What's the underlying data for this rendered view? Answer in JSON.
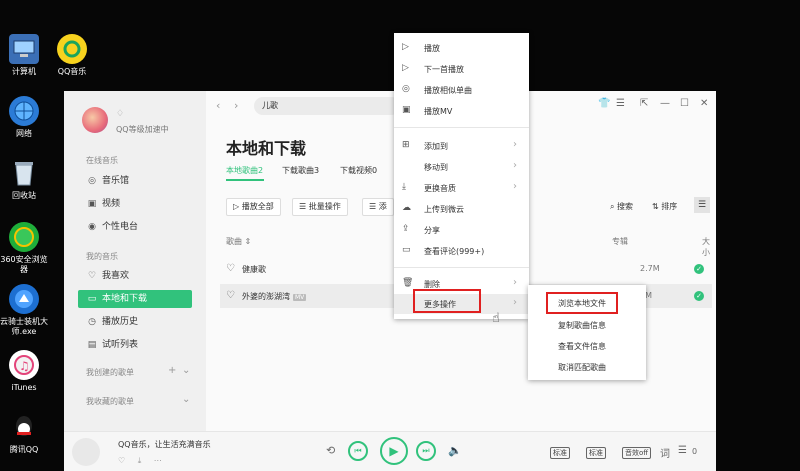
{
  "desktop": {
    "icons": [
      {
        "label": "计算机",
        "icon": "computer-icon"
      },
      {
        "label": "QQ音乐",
        "icon": "qqmusic-icon"
      },
      {
        "label": "网络",
        "icon": "network-icon"
      },
      {
        "label": "回收站",
        "icon": "recycle-bin-icon"
      },
      {
        "label": "360安全浏览器",
        "icon": "browser-icon"
      },
      {
        "label": "云骑士装机大师.exe",
        "icon": "installer-icon"
      },
      {
        "label": "iTunes",
        "icon": "itunes-icon"
      },
      {
        "label": "腾讯QQ",
        "icon": "qq-icon"
      }
    ]
  },
  "sidebar": {
    "user_status": "QQ等级加速中",
    "online_music_label": "在线音乐",
    "online_items": [
      {
        "label": "音乐馆",
        "icon": "music-hall-icon"
      },
      {
        "label": "视频",
        "icon": "video-icon"
      },
      {
        "label": "个性电台",
        "icon": "radio-icon"
      }
    ],
    "my_music_label": "我的音乐",
    "my_items": [
      {
        "label": "我喜欢",
        "icon": "heart-icon"
      },
      {
        "label": "本地和下载",
        "icon": "monitor-icon"
      },
      {
        "label": "播放历史",
        "icon": "history-icon"
      },
      {
        "label": "试听列表",
        "icon": "list-icon"
      }
    ],
    "created_playlists_label": "我创建的歌单",
    "collected_playlists_label": "我收藏的歌单"
  },
  "topbar": {
    "search_value": "儿歌"
  },
  "main": {
    "title": "本地和下载",
    "tabs": [
      "本地歌曲2",
      "下载歌曲3",
      "下载视频0"
    ],
    "buttons": {
      "play_all": "播放全部",
      "batch": "批量操作",
      "add": "添"
    },
    "tools": {
      "search": "搜索",
      "sort": "排序"
    },
    "columns": {
      "song": "歌曲",
      "album": "专辑",
      "size": "大小"
    },
    "songs": [
      {
        "name": "健康歌",
        "mv": "",
        "size": "2.7M"
      },
      {
        "name": "外婆的澎湖湾",
        "mv": "MV",
        "size": "9M"
      }
    ]
  },
  "player": {
    "now_playing": "QQ音乐，让生活充满音乐",
    "mode": "标准",
    "quality": "标准",
    "sound": "音效off",
    "count": "0"
  },
  "context_menu": {
    "items": [
      {
        "label": "播放",
        "icon": "play-icon"
      },
      {
        "label": "下一首播放",
        "icon": "play-next-icon"
      },
      {
        "label": "播放相似单曲",
        "icon": "similar-icon"
      },
      {
        "label": "播放MV",
        "icon": "mv-icon"
      },
      {
        "label": "添加到",
        "icon": "add-icon"
      },
      {
        "label": "移动到",
        "icon": ""
      },
      {
        "label": "更换音质",
        "icon": "download-icon"
      },
      {
        "label": "上传到微云",
        "icon": "cloud-icon"
      },
      {
        "label": "分享",
        "icon": "share-icon"
      },
      {
        "label": "查看评论(999+)",
        "icon": "comment-icon"
      },
      {
        "label": "删除",
        "icon": "trash-icon"
      },
      {
        "label": "更多操作",
        "icon": ""
      }
    ]
  },
  "submenu": {
    "items": [
      "浏览本地文件",
      "复制歌曲信息",
      "查看文件信息",
      "取消匹配歌曲"
    ]
  },
  "colors": {
    "accent": "#31c27c",
    "highlight": "#e02020"
  }
}
